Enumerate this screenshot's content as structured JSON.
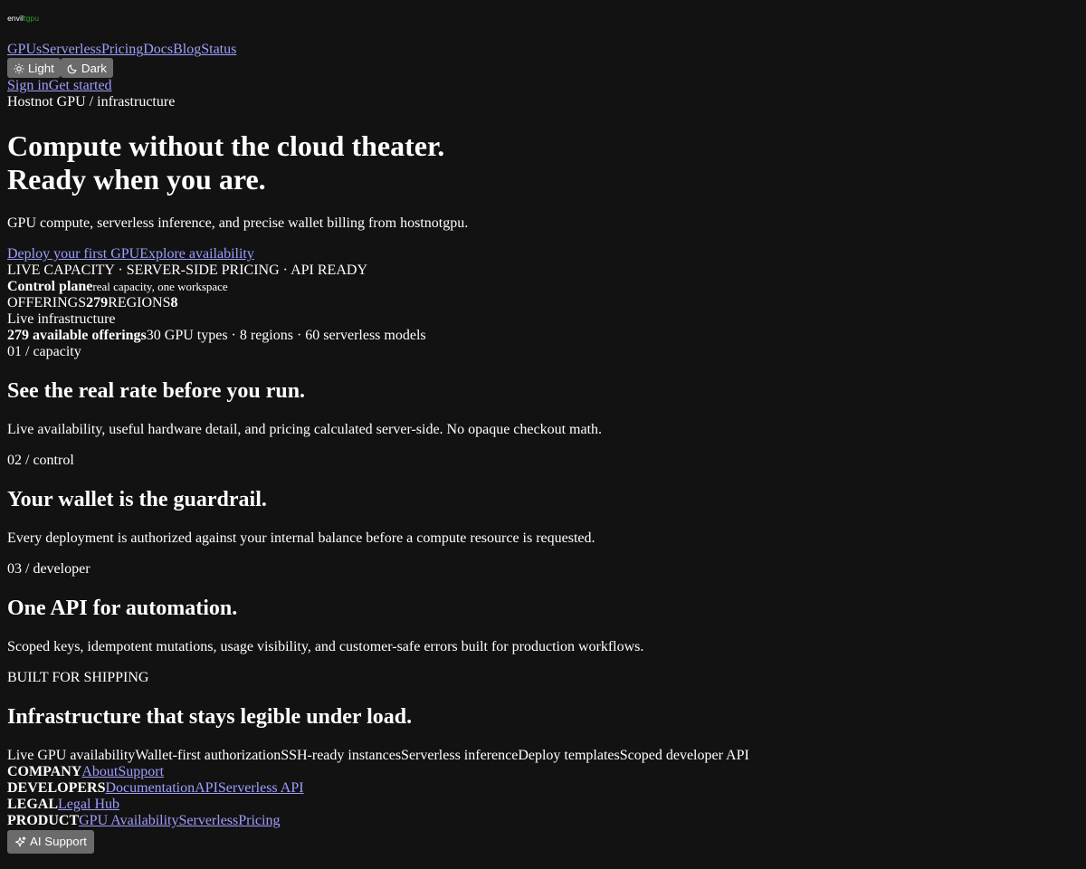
{
  "brand": {
    "logo_white": "env",
    "logo_mid": "il",
    "logo_green": "tgpu",
    "colors": {
      "background": "#121212",
      "text": "#ffffff",
      "link": "#9e9eff",
      "button": "#6b6b6b",
      "logo_green": "#2e9e2e"
    }
  },
  "nav": {
    "items": [
      {
        "label": "GPUs"
      },
      {
        "label": "Serverless"
      },
      {
        "label": "Pricing"
      },
      {
        "label": "Docs"
      },
      {
        "label": "Blog"
      },
      {
        "label": "Status"
      }
    ]
  },
  "theme": {
    "light_label": "Light",
    "dark_label": "Dark",
    "light_icon": "sun-icon",
    "dark_icon": "moon-icon"
  },
  "auth": {
    "sign_in": "Sign in",
    "get_started": "Get started"
  },
  "breadcrumb": "Hostnot GPU / infrastructure",
  "hero": {
    "title_line1": "Compute without the cloud theater.",
    "title_line2": "Ready when you are.",
    "subtitle": "GPU compute, serverless inference, and precise wallet billing from hostnotgpu.",
    "cta_primary": "Deploy your first GPU",
    "cta_secondary": "Explore availability",
    "tagline": "LIVE CAPACITY · SERVER-SIDE PRICING · API READY"
  },
  "control_plane": {
    "label": "Control plane",
    "desc": "real capacity, one workspace",
    "offerings_label": "OFFERINGS",
    "offerings_value": "279",
    "regions_label": "REGIONS",
    "regions_value": "8",
    "live_label": "Live infrastructure",
    "available": "279 available offerings",
    "summary": "30 GPU types · 8 regions · 60 serverless models"
  },
  "features": [
    {
      "eyebrow": "01 / capacity",
      "title": "See the real rate before you run.",
      "body": "Live availability, useful hardware detail, and pricing calculated server-side. No opaque checkout math."
    },
    {
      "eyebrow": "02 / control",
      "title": "Your wallet is the guardrail.",
      "body": "Every deployment is authorized against your internal balance before a compute resource is requested."
    },
    {
      "eyebrow": "03 / developer",
      "title": "One API for automation.",
      "body": "Scoped keys, idempotent mutations, usage visibility, and customer-safe errors built for production workflows."
    }
  ],
  "shipping": {
    "eyebrow": "BUILT FOR SHIPPING",
    "title": "Infrastructure that stays legible under load.",
    "items": [
      "Live GPU availability",
      "Wallet-first authorization",
      "SSH-ready instances",
      "Serverless inference",
      "Deploy templates",
      "Scoped developer API"
    ]
  },
  "footer": {
    "company": {
      "heading": "COMPANY",
      "links": [
        "About",
        "Support"
      ]
    },
    "developers": {
      "heading": "DEVELOPERS",
      "links": [
        "Documentation",
        "API",
        "Serverless API"
      ]
    },
    "legal": {
      "heading": "LEGAL",
      "links": [
        "Legal Hub"
      ]
    },
    "product": {
      "heading": "PRODUCT",
      "links": [
        "GPU Availability",
        "Serverless",
        "Pricing"
      ]
    }
  },
  "ai_support": {
    "label": "AI Support",
    "icon": "sparkle-icon"
  }
}
